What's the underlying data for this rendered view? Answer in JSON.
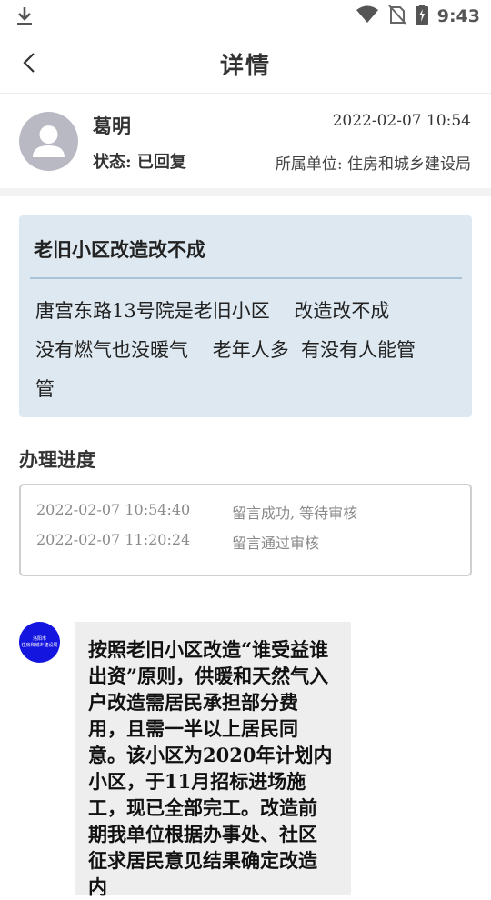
{
  "status_bar": {
    "time": "9:43",
    "icons": [
      "download-icon",
      "wifi-icon",
      "no-sim-icon",
      "battery-charging-icon"
    ]
  },
  "nav": {
    "title": "详情",
    "back_icon": "chevron-left-icon"
  },
  "user": {
    "name": "葛明",
    "datetime": "2022-02-07  10:54",
    "status": "状态:  已回复",
    "department": "所属单位:  住房和城乡建设局"
  },
  "message": {
    "title": "老旧小区改造改不成",
    "body": "唐宫东路13号院是老旧小区    改造改不成\n没有燃气也没暖气    老年人多  有没有人能管\n管"
  },
  "progress": {
    "title": "办理进度",
    "entries": [
      {
        "time": "2022-02-07  10:54:40",
        "text": "留言成功, 等待审核"
      },
      {
        "time": "2022-02-07  11:20:24",
        "text": "留言通过审核"
      }
    ]
  },
  "reply": {
    "avatar_lines": [
      "洛阳市",
      "住房和城乡建设局"
    ],
    "text": "按照老旧小区改造“谁受益谁出资”原则，供暖和天然气入户改造需居民承担部分费用，且需一半以上居民同意。该小区为2020年计划内小区，于11月招标进场施工，现已全部完工。改造前期我单位根据办事处、社区征求居民意见结果确定改造内"
  },
  "colors": {
    "card_bg": "#dde8f0",
    "reply_avatar_bg": "#1515e0",
    "bubble_bg": "#eeeeee"
  }
}
